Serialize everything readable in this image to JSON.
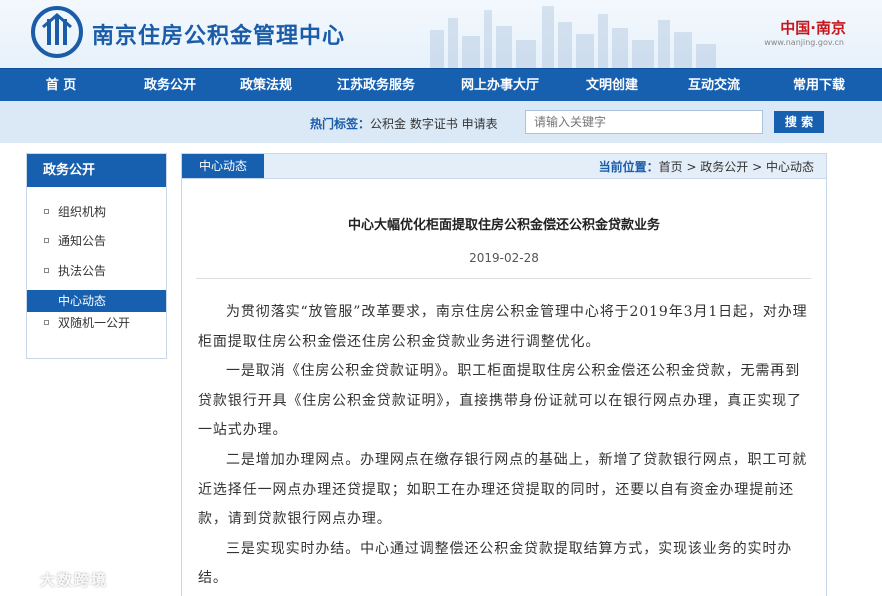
{
  "header": {
    "site_title": "南京住房公积金管理中心",
    "city_brand": "中国·南京",
    "city_url": "www.nanjing.gov.cn"
  },
  "nav": {
    "items": [
      "首 页",
      "政务公开",
      "政策法规",
      "江苏政务服务",
      "网上办事大厅",
      "文明创建",
      "互动交流",
      "常用下载"
    ]
  },
  "search": {
    "hot_label": "热门标签：",
    "hot_tags": "公积金 数字证书 申请表",
    "placeholder": "请输入关键字",
    "button": "搜 索"
  },
  "sidebar": {
    "title": "政务公开",
    "items": [
      "组织机构",
      "通知公告",
      "执法公告",
      "中心动态",
      "双随机一公开"
    ],
    "active": "中心动态"
  },
  "main": {
    "tab": "中心动态",
    "breadcrumb_label": "当前位置：",
    "breadcrumb": "首页 > 政务公开 > 中心动态"
  },
  "article": {
    "title": "中心大幅优化柜面提取住房公积金偿还公积金贷款业务",
    "date": "2019-02-28",
    "paragraphs": [
      "为贯彻落实“放管服”改革要求，南京住房公积金管理中心将于2019年3月1日起，对办理柜面提取住房公积金偿还住房公积金贷款业务进行调整优化。",
      "一是取消《住房公积金贷款证明》。职工柜面提取住房公积金偿还公积金贷款，无需再到贷款银行开具《住房公积金贷款证明》，直接携带身份证就可以在银行网点办理，真正实现了一站式办理。",
      "二是增加办理网点。办理网点在缴存银行网点的基础上，新增了贷款银行网点，职工可就近选择任一网点办理还贷提取；如职工在办理还贷提取的同时，还要以自有资金办理提前还款，请到贷款银行网点办理。",
      "三是实现实时办结。中心通过调整偿还公积金贷款提取结算方式，实现该业务的实时办结。"
    ]
  },
  "watermark": {
    "text": "大数跨境"
  }
}
